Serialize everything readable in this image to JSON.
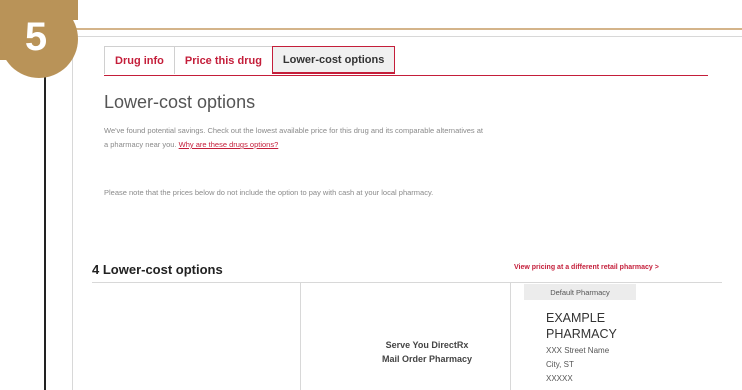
{
  "step": {
    "number": "5"
  },
  "tabs": [
    {
      "label": "Drug info",
      "active": false
    },
    {
      "label": "Price this drug",
      "active": false
    },
    {
      "label": "Lower-cost options",
      "active": true
    }
  ],
  "page": {
    "title": "Lower-cost options",
    "intro_text": "We've found potential savings. Check out the lowest available price for this drug and its comparable alternatives at a pharmacy near you.",
    "intro_link": "Why are these drugs options?",
    "note_text": "Please note that the prices below do not include the option to pay with cash at your local pharmacy."
  },
  "results": {
    "heading": "4 Lower-cost options",
    "view_pricing_link": "View pricing at a different retail pharmacy >",
    "default_label": "Default Pharmacy",
    "provider_line1": "Serve You DirectRx",
    "provider_line2": "Mail Order Pharmacy",
    "pharmacy_name_line1": "EXAMPLE",
    "pharmacy_name_line2": "PHARMACY",
    "address_line1": "XXX Street Name",
    "address_line2": "City, ST",
    "address_line3": "XXXXX"
  },
  "colors": {
    "accent": "#c41e3a",
    "badge": "#b99358"
  }
}
